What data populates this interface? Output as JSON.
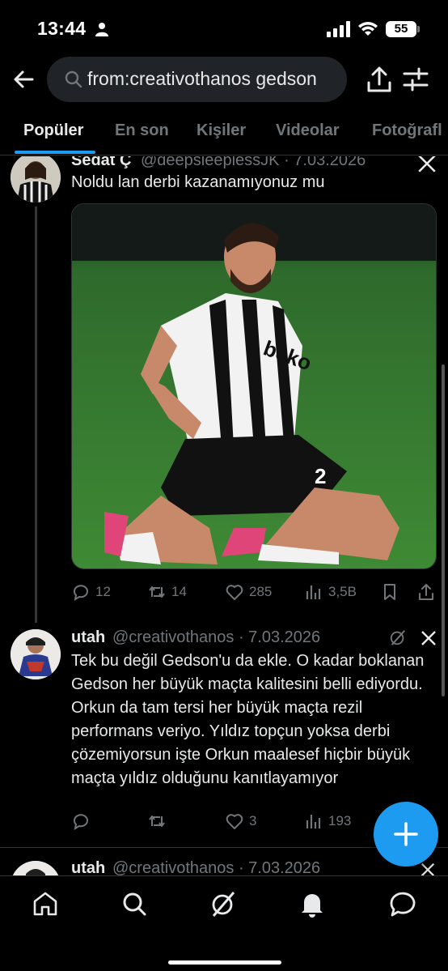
{
  "status_bar": {
    "time": "13:44",
    "battery": "55"
  },
  "search": {
    "query": "from:creativothanos gedson"
  },
  "tabs": [
    {
      "label": "Popüler"
    },
    {
      "label": "En son"
    },
    {
      "label": "Kişiler"
    },
    {
      "label": "Videolar"
    },
    {
      "label": "Fotoğrafl"
    }
  ],
  "tweets": [
    {
      "name": "Sedat Ç",
      "handle": "@deepsleeplessJK · 7.03.2026",
      "text": "Noldu lan derbi kazanamıyonuz mu",
      "replies": "12",
      "retweets": "14",
      "likes": "285",
      "views": "3,5B"
    },
    {
      "name": "utah",
      "handle": "@creativothanos · 7.03.2026",
      "text": "Tek bu değil Gedson'u da ekle. O kadar boklanan Gedson her büyük maçta kalitesini belli ediyordu. Orkun da tam tersi her büyük maçta rezil performans veriyo. Yıldız topçun yoksa derbi çözemiyorsun işte Orkun maalesef hiçbir büyük maçta yıldız olduğunu kanıtlayamıyor",
      "replies": "",
      "retweets": "",
      "likes": "3",
      "views": "193"
    },
    {
      "name": "utah",
      "handle": "@creativothanos · 7.03.2026"
    }
  ],
  "colors": {
    "accent": "#1d9bf0",
    "background": "#000000",
    "muted": "#71767b"
  }
}
